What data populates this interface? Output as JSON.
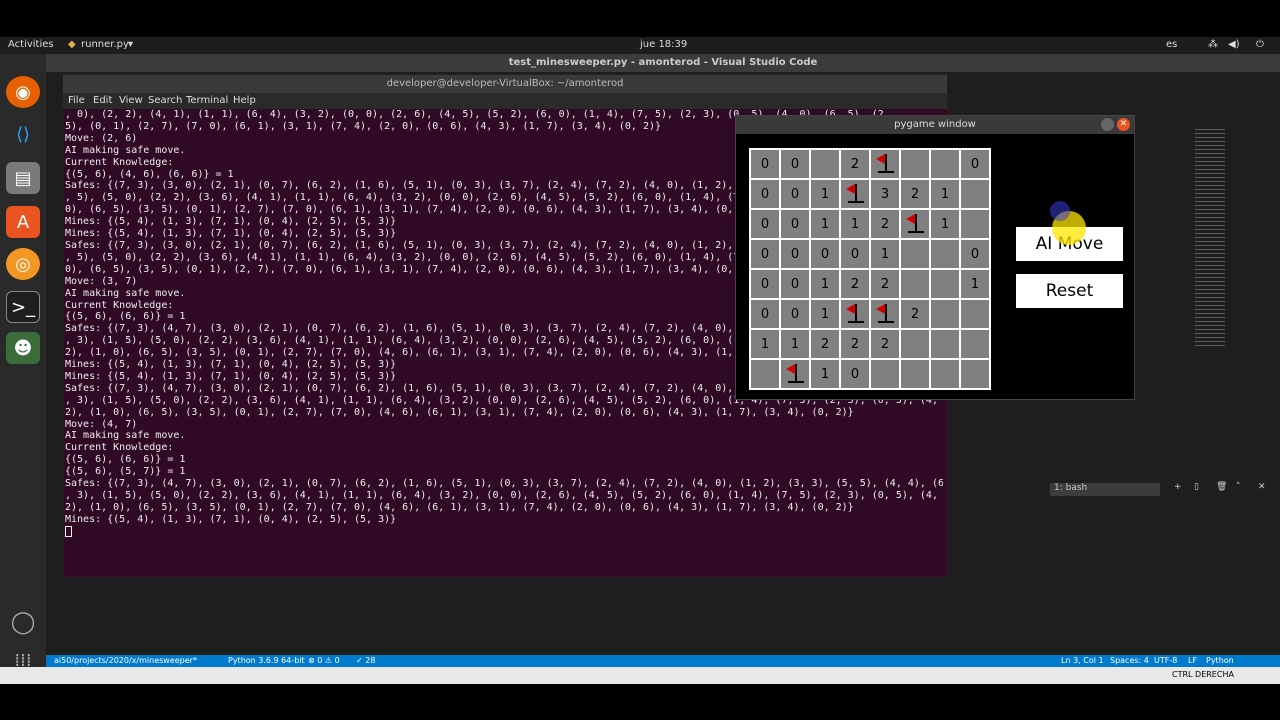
{
  "topbar": {
    "activities": "Activities",
    "app": "runner.py",
    "clock": "jue 18:39",
    "lang": "es"
  },
  "vscode": {
    "title": "test_minesweeper.py - amonterod - Visual Studio Code",
    "panel": "1: bash",
    "status": {
      "path": "ai50/projects/2020/x/minesweeper*",
      "python": "Python 3.6.9 64-bit",
      "errors": "⊗ 0 ⚠ 0",
      "notes": "✓ 28",
      "position": "Ln 3, Col 1",
      "spaces": "Spaces: 4",
      "encoding": "UTF-8",
      "eol": "LF",
      "lang": "Python"
    }
  },
  "vbox": {
    "key": "CTRL DERECHA"
  },
  "terminal": {
    "title": "developer@developer-VirtualBox: ~/amonterod",
    "menu": [
      "File",
      "Edit",
      "View",
      "Search",
      "Terminal",
      "Help"
    ],
    "lines": [
      ", 0), (2, 2), (4, 1), (1, 1), (6, 4), (3, 2), (0, 0), (2, 6), (4, 5), (5, 2), (6, 0), (1, 4), (7, 5), (2, 3), (0, 5), (4, 0), (6, 5), (2,",
      "5), (0, 1), (2, 7), (7, 0), (6, 1), (3, 1), (7, 4), (2, 0), (0, 6), (4, 3), (1, 7), (3, 4), (0, 2)}",
      "Move: (2, 6)",
      "AI making safe move.",
      "Current Knowledge:",
      "{(5, 6), (4, 6), (6, 6)} = 1",
      "Safes: {(7, 3), (3, 0), (2, 1), (0, 7), (6, 2), (1, 6), (5, 1), (0, 3), (3, 7), (2, 4), (7, 2), (4, 0), (1, 2),",
      ", 5), (5, 0), (2, 2), (3, 6), (4, 1), (1, 1), (6, 4), (3, 2), (0, 0), (2, 6), (4, 5), (5, 2), (6, 0), (1, 4), (7",
      "0), (6, 5), (3, 5), (0, 1), (2, 7), (7, 0), (6, 1), (3, 1), (7, 4), (2, 0), (0, 6), (4, 3), (1, 7), (3, 4), (0,",
      "Mines: {(5, 4), (1, 3), (7, 1), (0, 4), (2, 5), (5, 3)}",
      "Mines: {(5, 4), (1, 3), (7, 1), (0, 4), (2, 5), (5, 3)}",
      "Safes: {(7, 3), (3, 0), (2, 1), (0, 7), (6, 2), (1, 6), (5, 1), (0, 3), (3, 7), (2, 4), (7, 2), (4, 0), (1, 2),",
      ", 5), (5, 0), (2, 2), (3, 6), (4, 1), (1, 1), (6, 4), (3, 2), (0, 0), (2, 6), (4, 5), (5, 2), (6, 0), (1, 4), (7",
      "0), (6, 5), (3, 5), (0, 1), (2, 7), (7, 0), (6, 1), (3, 1), (7, 4), (2, 0), (0, 6), (4, 3), (1, 7), (3, 4), (0,",
      "Move: (3, 7)",
      "AI making safe move.",
      "Current Knowledge:",
      "{(5, 6), (6, 6)} = 1",
      "Safes: {(7, 3), (4, 7), (3, 0), (2, 1), (0, 7), (6, 2), (1, 6), (5, 1), (0, 3), (3, 7), (2, 4), (7, 2), (4, 0),",
      ", 3), (1, 5), (5, 0), (2, 2), (3, 6), (4, 1), (1, 1), (6, 4), (3, 2), (0, 0), (2, 6), (4, 5), (5, 2), (6, 0), (",
      "2), (1, 0), (6, 5), (3, 5), (0, 1), (2, 7), (7, 0), (4, 6), (6, 1), (3, 1), (7, 4), (2, 0), (0, 6), (4, 3), (1,",
      "Mines: {(5, 4), (1, 3), (7, 1), (0, 4), (2, 5), (5, 3)}",
      "Mines: {(5, 4), (1, 3), (7, 1), (0, 4), (2, 5), (5, 3)}",
      "Safes: {(7, 3), (4, 7), (3, 0), (2, 1), (0, 7), (6, 2), (1, 6), (5, 1), (0, 3), (3, 7), (2, 4), (7, 2), (4, 0), (1, 2), (3, 3), (5, 5), (4,",
      ", 3), (1, 5), (5, 0), (2, 2), (3, 6), (4, 1), (1, 1), (6, 4), (3, 2), (0, 0), (2, 6), (4, 5), (5, 2), (6, 0), (1, 4), (7, 5), (2, 3), (0, 5), (4,",
      "2), (1, 0), (6, 5), (3, 5), (0, 1), (2, 7), (7, 0), (4, 6), (6, 1), (3, 1), (7, 4), (2, 0), (0, 6), (4, 3), (1, 7), (3, 4), (0, 2)}",
      "Move: (4, 7)",
      "AI making safe move.",
      "Current Knowledge:",
      "{(5, 6), (6, 6)} = 1",
      "{(5, 6), (5, 7)} = 1",
      "Safes: {(7, 3), (4, 7), (3, 0), (2, 1), (0, 7), (6, 2), (1, 6), (5, 1), (0, 3), (3, 7), (2, 4), (7, 2), (4, 0), (1, 2), (3, 3), (5, 5), (4, 4), (6",
      ", 3), (1, 5), (5, 0), (2, 2), (3, 6), (4, 1), (1, 1), (6, 4), (3, 2), (0, 0), (2, 6), (4, 5), (5, 2), (6, 0), (1, 4), (7, 5), (2, 3), (0, 5), (4,",
      "2), (1, 0), (6, 5), (3, 5), (0, 1), (2, 7), (7, 0), (4, 6), (6, 1), (3, 1), (7, 4), (2, 0), (0, 6), (4, 3), (1, 7), (3, 4), (0, 2)}",
      "Mines: {(5, 4), (1, 3), (7, 1), (0, 4), (2, 5), (5, 3)}"
    ]
  },
  "pygame": {
    "title": "pygame window",
    "ai_move_label": "AI Move",
    "reset_label": "Reset",
    "board": [
      [
        "0",
        "0",
        "",
        "2",
        "F",
        "",
        "",
        "0"
      ],
      [
        "0",
        "0",
        "1",
        "F",
        "3",
        "2",
        "1",
        ""
      ],
      [
        "0",
        "0",
        "1",
        "1",
        "2",
        "F",
        "1",
        ""
      ],
      [
        "0",
        "0",
        "0",
        "0",
        "1",
        "",
        "",
        "0"
      ],
      [
        "0",
        "0",
        "1",
        "2",
        "2",
        "",
        "",
        "1"
      ],
      [
        "0",
        "0",
        "1",
        "F",
        "F",
        "2",
        "",
        ""
      ],
      [
        "1",
        "1",
        "2",
        "2",
        "2",
        "",
        "",
        ""
      ],
      [
        "",
        "F",
        "1",
        "0",
        "",
        "",
        "",
        ""
      ]
    ]
  }
}
